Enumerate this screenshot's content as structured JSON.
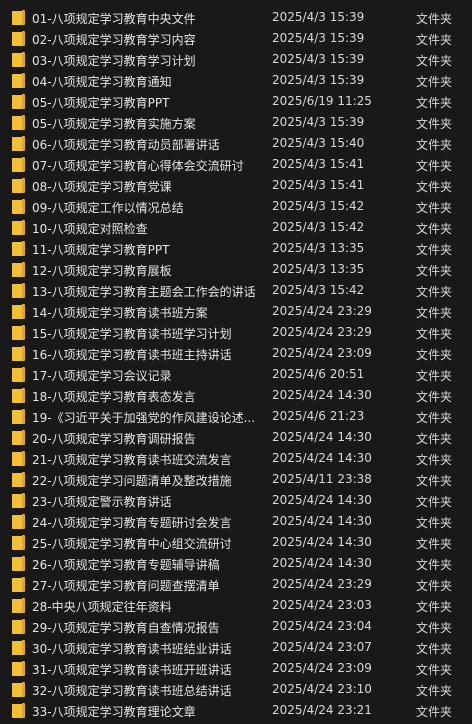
{
  "files": [
    {
      "name": "01-八项规定学习教育中央文件",
      "date": "2025/4/3 15:39",
      "type": "文件夹"
    },
    {
      "name": "02-八项规定学习教育学习内容",
      "date": "2025/4/3 15:39",
      "type": "文件夹"
    },
    {
      "name": "03-八项规定学习教育学习计划",
      "date": "2025/4/3 15:39",
      "type": "文件夹"
    },
    {
      "name": "04-八项规定学习教育通知",
      "date": "2025/4/3 15:39",
      "type": "文件夹"
    },
    {
      "name": "05-八项规定学习教育PPT",
      "date": "2025/6/19 11:25",
      "type": "文件夹"
    },
    {
      "name": "05-八项规定学习教育实施方案",
      "date": "2025/4/3 15:39",
      "type": "文件夹"
    },
    {
      "name": "06-八项规定学习教育动员部署讲话",
      "date": "2025/4/3 15:40",
      "type": "文件夹"
    },
    {
      "name": "07-八项规定学习教育心得体会交流研讨",
      "date": "2025/4/3 15:41",
      "type": "文件夹"
    },
    {
      "name": "08-八项规定学习教育党课",
      "date": "2025/4/3 15:41",
      "type": "文件夹"
    },
    {
      "name": "09-八项规定工作以情况总结",
      "date": "2025/4/3 15:42",
      "type": "文件夹"
    },
    {
      "name": "10-八项规定对照检查",
      "date": "2025/4/3 15:42",
      "type": "文件夹"
    },
    {
      "name": "11-八项规定学习教育PPT",
      "date": "2025/4/3 13:35",
      "type": "文件夹"
    },
    {
      "name": "12-八项规定学习教育展板",
      "date": "2025/4/3 13:35",
      "type": "文件夹"
    },
    {
      "name": "13-八项规定学习教育主题会工作会的讲话",
      "date": "2025/4/3 15:42",
      "type": "文件夹"
    },
    {
      "name": "14-八项规定学习教育读书班方案",
      "date": "2025/4/24 23:29",
      "type": "文件夹"
    },
    {
      "name": "15-八项规定学习教育读书班学习计划",
      "date": "2025/4/24 23:29",
      "type": "文件夹"
    },
    {
      "name": "16-八项规定学习教育读书班主持讲话",
      "date": "2025/4/24 23:09",
      "type": "文件夹"
    },
    {
      "name": "17-八项规定学习会议记录",
      "date": "2025/4/6 20:51",
      "type": "文件夹"
    },
    {
      "name": "18-八项规定学习教育表态发言",
      "date": "2025/4/24 14:30",
      "type": "文件夹"
    },
    {
      "name": "19-《习近平关于加强党的作风建设论述...",
      "date": "2025/4/6 21:23",
      "type": "文件夹"
    },
    {
      "name": "20-八项规定学习教育调研报告",
      "date": "2025/4/24 14:30",
      "type": "文件夹"
    },
    {
      "name": "21-八项规定学习教育读书班交流发言",
      "date": "2025/4/24 14:30",
      "type": "文件夹"
    },
    {
      "name": "22-八项规定学习问题清单及整改措施",
      "date": "2025/4/11 23:38",
      "type": "文件夹"
    },
    {
      "name": "23-八项规定警示教育讲话",
      "date": "2025/4/24 14:30",
      "type": "文件夹"
    },
    {
      "name": "24-八项规定学习教育专题研讨会发言",
      "date": "2025/4/24 14:30",
      "type": "文件夹"
    },
    {
      "name": "25-八项规定学习教育中心组交流研讨",
      "date": "2025/4/24 14:30",
      "type": "文件夹"
    },
    {
      "name": "26-八项规定学习教育专题辅导讲稿",
      "date": "2025/4/24 14:30",
      "type": "文件夹"
    },
    {
      "name": "27-八项规定学习教育问题查摆清单",
      "date": "2025/4/24 23:29",
      "type": "文件夹"
    },
    {
      "name": "28-中央八项规定往年资料",
      "date": "2025/4/24 23:03",
      "type": "文件夹"
    },
    {
      "name": "29-八项规定学习教育自查情况报告",
      "date": "2025/4/24 23:04",
      "type": "文件夹"
    },
    {
      "name": "30-八项规定学习教育读书班结业讲话",
      "date": "2025/4/24 23:07",
      "type": "文件夹"
    },
    {
      "name": "31-八项规定学习教育读书班开班讲话",
      "date": "2025/4/24 23:09",
      "type": "文件夹"
    },
    {
      "name": "32-八项规定学习教育读书班总结讲话",
      "date": "2025/4/24 23:10",
      "type": "文件夹"
    },
    {
      "name": "33-八项规定学习教育理论文章",
      "date": "2025/4/24 23:21",
      "type": "文件夹"
    }
  ],
  "icons": {
    "folder": "folder-icon"
  },
  "colors": {
    "background": "#191919",
    "folder": "#f2c038",
    "text": "#e6e6e6"
  }
}
